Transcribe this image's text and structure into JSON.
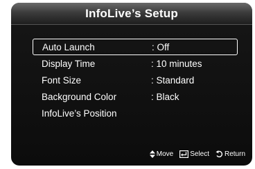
{
  "window": {
    "title": "InfoLive’s Setup"
  },
  "menu": {
    "items": [
      {
        "label": "Auto Launch",
        "value": ": Off"
      },
      {
        "label": "Display Time",
        "value": ": 10 minutes"
      },
      {
        "label": "Font Size",
        "value": ": Standard"
      },
      {
        "label": "Background Color",
        "value": ": Black"
      },
      {
        "label": "InfoLive’s Position",
        "value": ""
      }
    ],
    "selected_index": 0
  },
  "footer": {
    "move_label": "Move",
    "select_label": "Select",
    "return_label": "Return",
    "icons": [
      "up-down-arrow-icon",
      "enter-icon",
      "return-icon"
    ]
  },
  "colors": {
    "panel": "#0c0c0c",
    "text": "#ffffff",
    "title_bar": "#3c3c3c"
  }
}
